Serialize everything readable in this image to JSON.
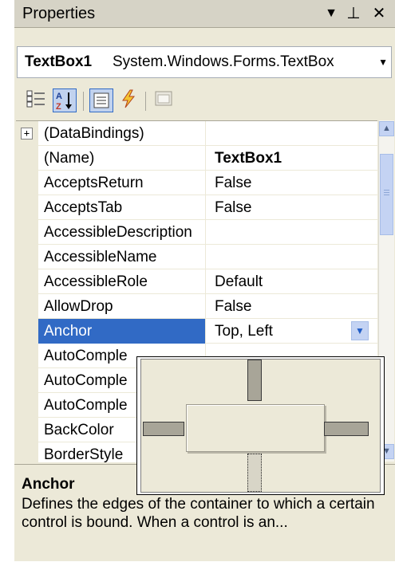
{
  "window": {
    "title": "Properties",
    "controls": [
      "▼",
      "⊥",
      "✕"
    ]
  },
  "object_selector": {
    "name": "TextBox1",
    "type": "System.Windows.Forms.TextBox"
  },
  "toolbar": {
    "icons": [
      "categorized-icon",
      "alphabetical-icon",
      "properties-icon",
      "events-icon",
      "property-pages-icon"
    ],
    "az_label": "A\nZ"
  },
  "properties": [
    {
      "name": "(DataBindings)",
      "value": ""
    },
    {
      "name": "(Name)",
      "value": "TextBox1"
    },
    {
      "name": "AcceptsReturn",
      "value": "False"
    },
    {
      "name": "AcceptsTab",
      "value": "False"
    },
    {
      "name": "AccessibleDescription",
      "value": ""
    },
    {
      "name": "AccessibleName",
      "value": ""
    },
    {
      "name": "AccessibleRole",
      "value": "Default"
    },
    {
      "name": "AllowDrop",
      "value": "False"
    },
    {
      "name": "Anchor",
      "value": "Top, Left"
    },
    {
      "name": "AutoComple",
      "value": ""
    },
    {
      "name": "AutoComple",
      "value": ""
    },
    {
      "name": "AutoComple",
      "value": ""
    },
    {
      "name": "BackColor",
      "value": ""
    },
    {
      "name": "BorderStyle",
      "value": ""
    }
  ],
  "selected_property": "Anchor",
  "anchor_editor": {
    "top": true,
    "left": true,
    "right": false,
    "bottom": false
  },
  "description": {
    "title": "Anchor",
    "text": "Defines the edges of the container to which a certain control is bound. When a control is an..."
  },
  "colors": {
    "selection": "#316ac5",
    "panel": "#ece9d8",
    "scroll": "#c4d3f3"
  }
}
